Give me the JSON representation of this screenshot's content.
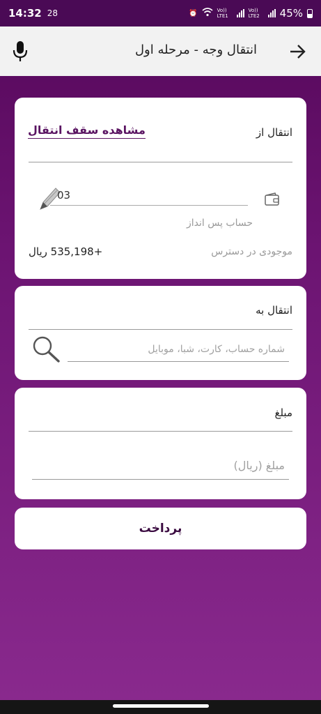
{
  "status_bar": {
    "time": "14:32",
    "temperature": "28",
    "battery": "45%",
    "network_labels": [
      "Vo)) LTE1",
      "Vo)) LTE2"
    ]
  },
  "header": {
    "title": "انتقال وجه - مرحله اول"
  },
  "from_card": {
    "label": "انتقال از",
    "limit_link": "مشاهده سقف انتقال",
    "account_value": "03",
    "account_type": "حساب پس انداز",
    "balance_label": "موجودی در دسترس",
    "balance_value": "+535,198 ریال"
  },
  "to_card": {
    "label": "انتقال به",
    "placeholder": "شماره حساب، کارت، شبا، موبایل"
  },
  "amount_card": {
    "label": "مبلغ",
    "placeholder": "مبلغ (ریال)"
  },
  "pay_button": {
    "label": "پرداخت"
  }
}
